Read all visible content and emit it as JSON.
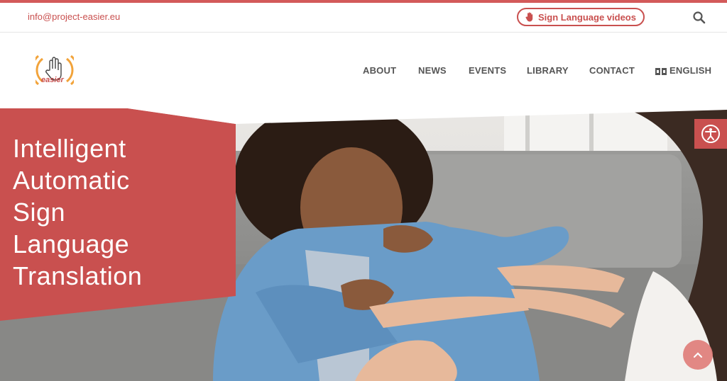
{
  "topbar": {
    "email": "info@project-easier.eu",
    "sign_language_button": "Sign Language videos"
  },
  "logo": {
    "text": "easier"
  },
  "nav": {
    "items": [
      "ABOUT",
      "NEWS",
      "EVENTS",
      "LIBRARY",
      "CONTACT"
    ],
    "language": "ENGLISH"
  },
  "hero": {
    "headline_lines": [
      "Intelligent",
      "Automatic",
      "Sign",
      "Language",
      "Translation"
    ]
  },
  "colors": {
    "brand": "#c9504f",
    "brand_light": "#d35a5a",
    "logo_orange": "#f2a33a",
    "nav_text": "#555555"
  },
  "icons": {
    "search": "search-icon",
    "hand": "hand-icon",
    "accessibility": "accessibility-icon",
    "scroll_top": "chevron-up-icon",
    "language": "language-icon"
  }
}
